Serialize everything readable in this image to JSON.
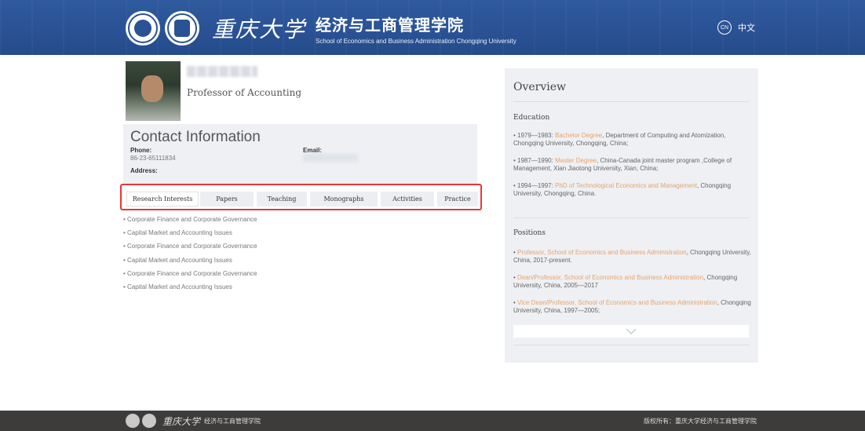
{
  "header": {
    "calligraphy": "重庆大学",
    "school_cn": "经济与工商管理学院",
    "school_en": "School of Economics and Business Administration Chongqing University",
    "lang_badge": "CN",
    "lang_label": "中文"
  },
  "profile": {
    "title": "Professor of Accounting"
  },
  "contact": {
    "heading": "Contact Information",
    "phone_label": "Phone:",
    "phone_value": "86-23-65111834",
    "email_label": "Email:",
    "address_label": "Address:"
  },
  "tabs": [
    "Research Interests",
    "Papers",
    "Teaching",
    "Monographs",
    "Activities",
    "Practice"
  ],
  "active_tab": "Research Interests",
  "interests": [
    "Corporate Finance and Corporate Governance",
    "Capital Market and Accounting Issues",
    "Corporate Finance and Corporate Governance",
    "Capital Market and Accounting Issues",
    "Corporate Finance and Corporate Governance",
    "Capital Market and Accounting Issues"
  ],
  "overview": {
    "heading": "Overview",
    "education_title": "Education",
    "education": [
      {
        "pre": "1979—1983: ",
        "hl": "Bachelor Degree",
        "post": ", Department of Computing and Atomization, Chongqing University, Chongqing, China;"
      },
      {
        "pre": "1987—1990: ",
        "hl": "Master Degree",
        "post": ", China-Canada joint master program ,College of Management, Xian Jiaotong University, Xian, China;"
      },
      {
        "pre": "1994—1997: ",
        "hl": "PhD of Technological Economics and Management",
        "post": ", Chongqing University, Chongqing, China."
      }
    ],
    "positions_title": "Positions",
    "positions": [
      {
        "hl": "Professor, School of Economics and Business Administration",
        "post": ", Chongqing University, China, 2017-present."
      },
      {
        "hl": "Dean/Professor, School of Economics and Business Administration",
        "post": ", Chongqing University, China, 2005—2017"
      },
      {
        "hl": "Vice Dean/Professor, School of Economics and Business Administration",
        "post": ", Chongqing University, China, 1997—2005;"
      }
    ],
    "expand_icon": "chevron-down-icon"
  },
  "footer": {
    "calligraphy": "重庆大学",
    "school_cn": "经济与工商管理学院",
    "copyright": "版权所有：重庆大学经济与工商管理学院"
  },
  "colors": {
    "header_blue": "#2a5295",
    "highlight": "#e8a36a",
    "tab_outline": "#e53935",
    "panel_bg": "#eef0f3",
    "footer_bg": "#3e3c3b"
  }
}
